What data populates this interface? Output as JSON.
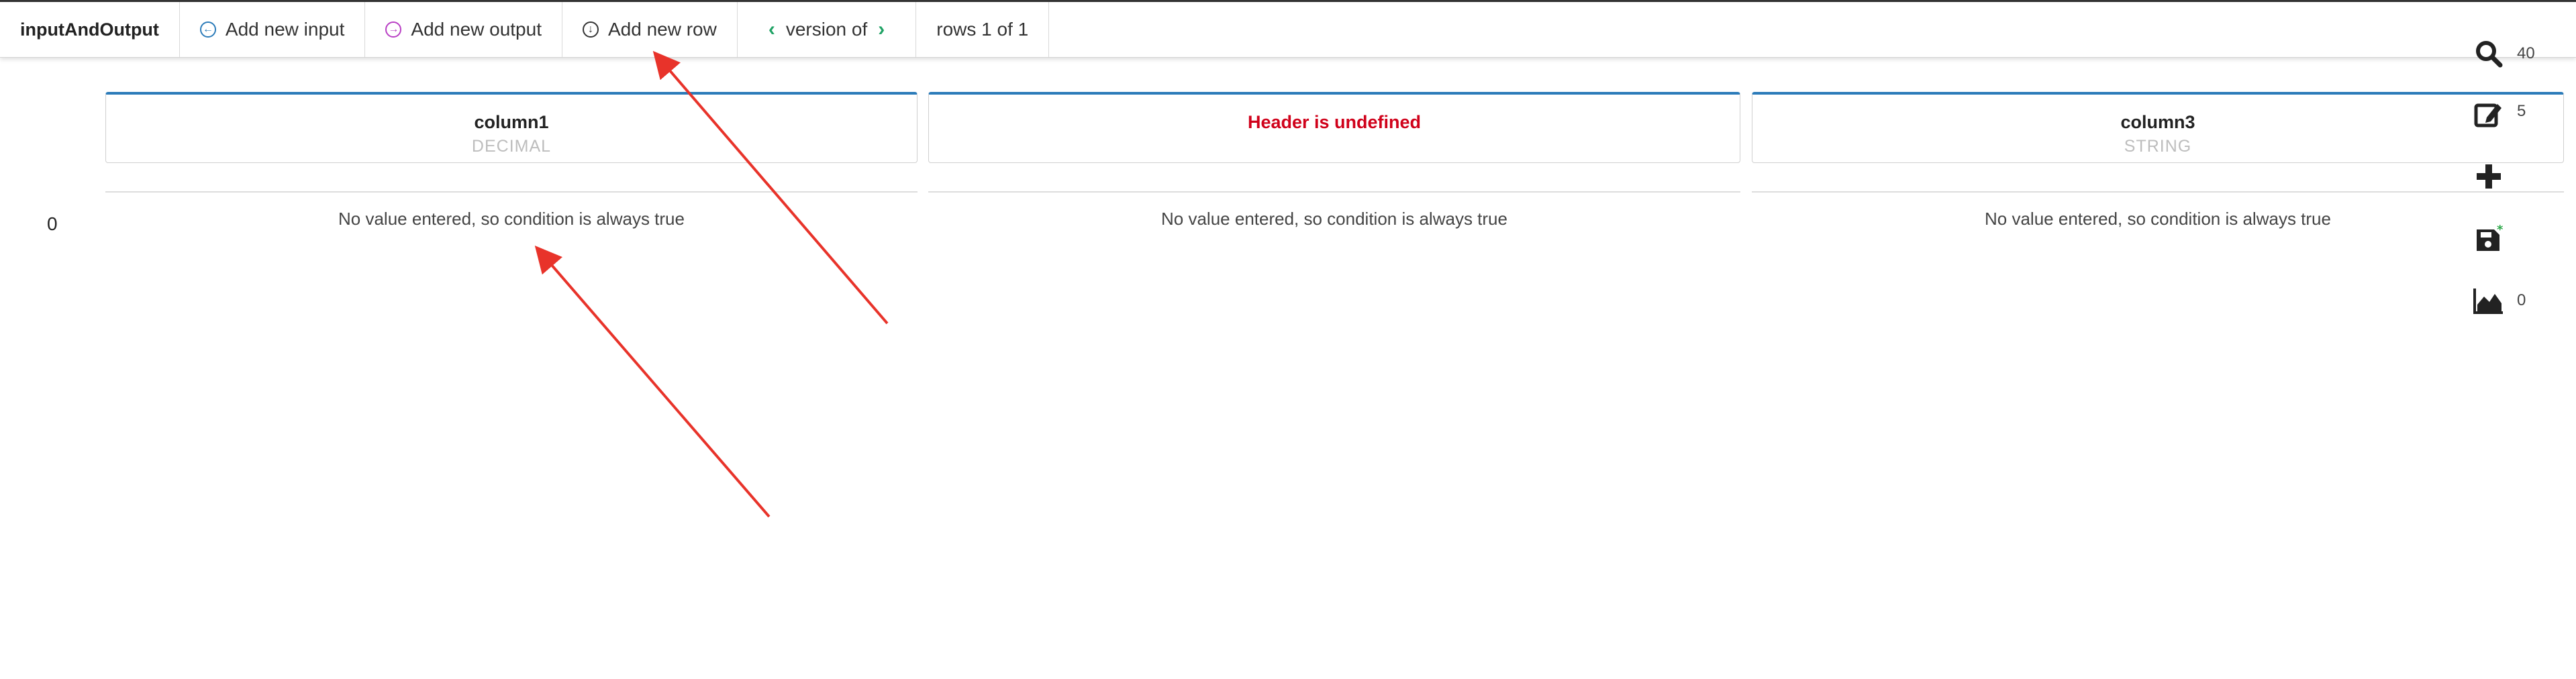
{
  "toolbar": {
    "title": "inputAndOutput",
    "add_input_label": "Add new input",
    "add_output_label": "Add new output",
    "add_row_label": "Add new row",
    "version_label": "version of",
    "rows_label": "rows 1 of 1"
  },
  "columns": [
    {
      "name": "column1",
      "type": "DECIMAL",
      "cell": "No value entered, so condition is always true"
    },
    {
      "name": "Header is undefined",
      "type": "",
      "cell": "No value entered, so condition is always true"
    },
    {
      "name": "column3",
      "type": "STRING",
      "cell": "No value entered, so condition is always true"
    }
  ],
  "rows": [
    {
      "index": "0"
    }
  ],
  "rail": {
    "search_count": "40",
    "edit_count": "5",
    "chart_count": "0"
  },
  "colors": {
    "accent_blue": "#2b7bb9",
    "error_red": "#d0021b",
    "version_green": "#21a366",
    "input_icon_blue": "#2b7bb9",
    "output_icon_purple": "#b83ec4",
    "save_badge_green": "#2ea84a",
    "annotation_arrow": "#e8332a"
  }
}
